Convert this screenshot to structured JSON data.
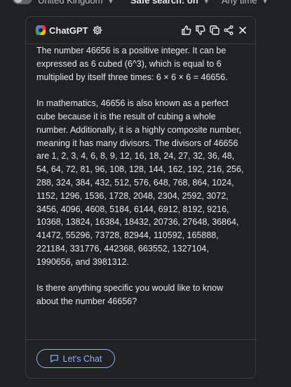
{
  "filters": {
    "region": "United Kingdom",
    "safe_search": "Safe search: on",
    "time": "Any time"
  },
  "card": {
    "brand": "ChatGPT",
    "icons": [
      "settings-icon",
      "thumbs-up-icon",
      "thumbs-down-icon",
      "copy-icon",
      "share-icon",
      "close-icon"
    ],
    "paragraphs": [
      "The number 46656 is a positive integer. It can be expressed as 6 cubed (6^3), which is equal to 6 multiplied by itself three times: 6 × 6 × 6 = 46656.",
      "In mathematics, 46656 is also known as a perfect cube because it is the result of cubing a whole number. Additionally, it is a highly composite number, meaning it has many divisors. The divisors of 46656 are 1, 2, 3, 4, 6, 8, 9, 12, 16, 18, 24, 27, 32, 36, 48, 54, 64, 72, 81, 96, 108, 128, 144, 162, 192, 216, 256, 288, 324, 384, 432, 512, 576, 648, 768, 864, 1024, 1152, 1296, 1536, 1728, 2048, 2304, 2592, 3072, 3456, 4096, 4608, 5184, 6144, 6912, 8192, 9216, 10368, 13824, 16384, 18432, 20736, 27648, 36864, 41472, 55296, 73728, 82944, 110592, 165888, 221184, 331776, 442368, 663552, 1327104, 1990656, and 3981312.",
      "Is there anything specific you would like to know about the number 46656?"
    ],
    "chat_button": "Let's Chat"
  },
  "colors": {
    "background": "#202124",
    "border": "#3c4043",
    "text": "#e8eaed",
    "accent": "#8ab4f8"
  }
}
